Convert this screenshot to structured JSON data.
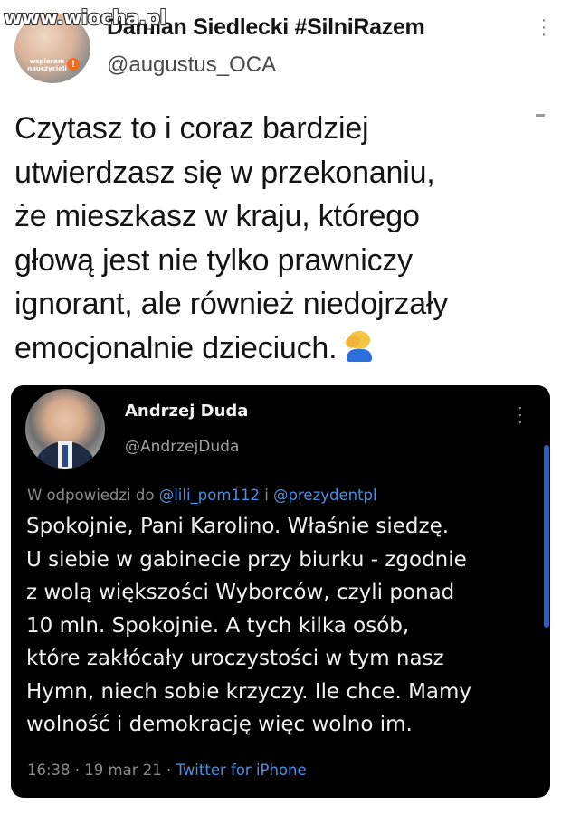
{
  "watermark": "www.wiocha.pl",
  "outer_tweet": {
    "author_name": "Damian Siedlecki #SilniRazem",
    "author_name_visible": "Damian Siedlecki #SilniRazem",
    "handle": "@augustus_OCA",
    "avatar_badge": "wspieram nauczycieli",
    "avatar_badge_mark": "!",
    "menu_icon": "more-vertical-icon",
    "text": "Czytasz to i coraz bardziej\nutwierdzasz się w przekonaniu,\nże mieszkasz w kraju, którego\ngłową jest nie tylko prawniczy\nignorant, ale również niedojrzały\nemocjonalnie dzieciuch.",
    "emoji": "facepalm-emoji"
  },
  "embedded_tweet": {
    "author_name": "Andrzej Duda",
    "handle": "@AndrzejDuda",
    "menu_icon": "more-vertical-icon",
    "reply_prefix": "W odpowiedzi do ",
    "reply_user_1": "@lili_pom112",
    "reply_joiner": " i ",
    "reply_user_2": "@prezydentpl",
    "text": "Spokojnie, Pani Karolino. Właśnie siedzę.\nU siebie w gabinecie przy biurku - zgodnie\nz wolą większości Wyborców, czyli ponad\n10 mln. Spokojnie. A tych kilka osób,\nktóre zakłócały uroczystości w tym nasz\nHymn, niech sobie krzyczy. Ile chce. Mamy\nwolność i demokrację więc wolno im.",
    "timestamp": "16:38 · 19 mar 21 · ",
    "source": "Twitter for iPhone"
  },
  "colors": {
    "embed_background": "#000000",
    "link": "#4a8fe0",
    "scroll_indicator": "#2f5fbf"
  }
}
